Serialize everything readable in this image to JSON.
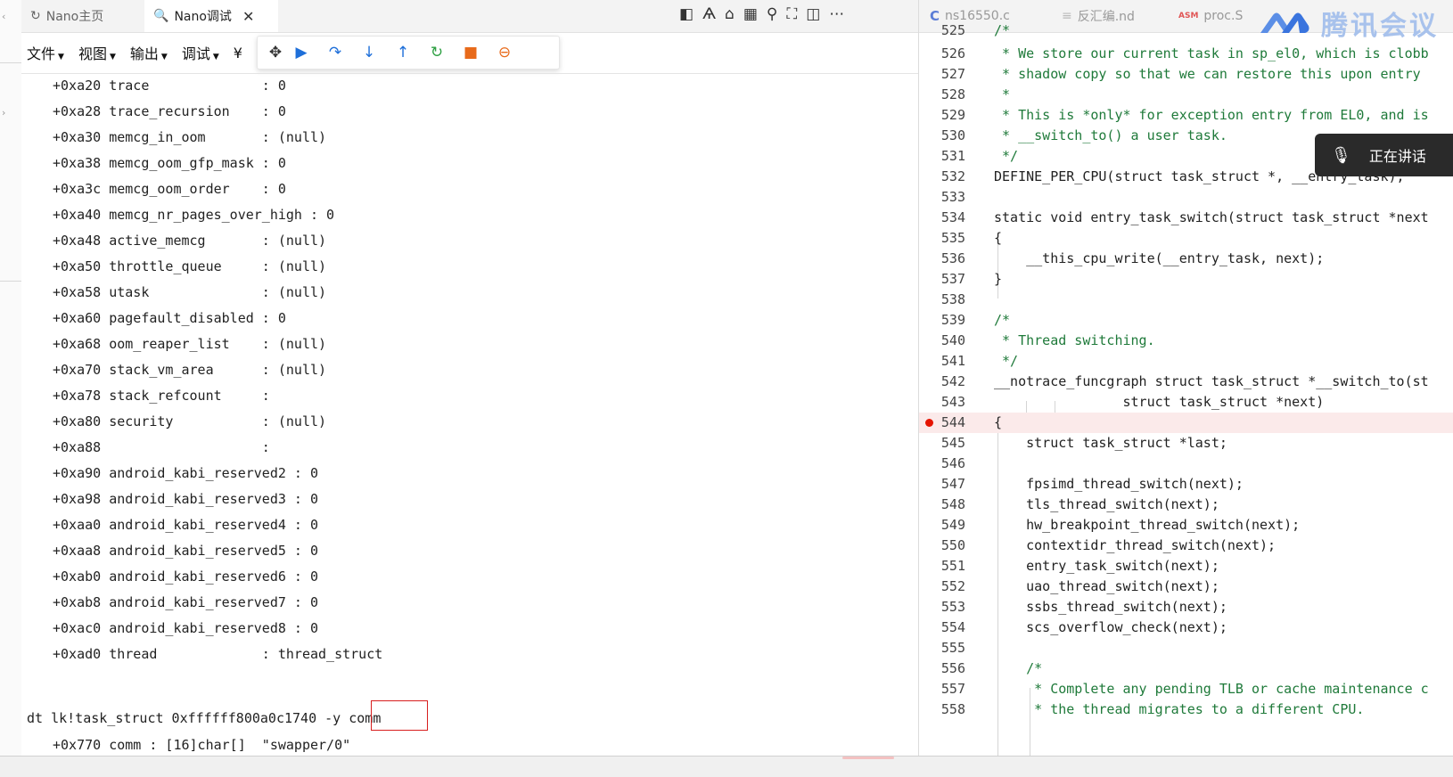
{
  "left_tabs": [
    {
      "label": "Nano主页",
      "active": false,
      "icon": "nano-home-icon"
    },
    {
      "label": "Nano调试",
      "active": true,
      "icon": "debug-search-icon"
    }
  ],
  "menu": [
    "文件",
    "视图",
    "输出",
    "调试",
    "¥"
  ],
  "debug_toolbar": [
    "move-handle-icon",
    "continue-icon",
    "step-over-icon",
    "step-into-icon",
    "step-out-icon",
    "restart-icon",
    "stop-icon",
    "disconnect-icon"
  ],
  "struct_rows": [
    "+0xa20 trace              : 0",
    "+0xa28 trace_recursion    : 0",
    "+0xa30 memcg_in_oom       : (null)",
    "+0xa38 memcg_oom_gfp_mask : 0",
    "+0xa3c memcg_oom_order    : 0",
    "+0xa40 memcg_nr_pages_over_high : 0",
    "+0xa48 active_memcg       : (null)",
    "+0xa50 throttle_queue     : (null)",
    "+0xa58 utask              : (null)",
    "+0xa60 pagefault_disabled : 0",
    "+0xa68 oom_reaper_list    : (null)",
    "+0xa70 stack_vm_area      : (null)",
    "+0xa78 stack_refcount     :",
    "+0xa80 security           : (null)",
    "+0xa88                    :",
    "+0xa90 android_kabi_reserved2 : 0",
    "+0xa98 android_kabi_reserved3 : 0",
    "+0xaa0 android_kabi_reserved4 : 0",
    "+0xaa8 android_kabi_reserved5 : 0",
    "+0xab0 android_kabi_reserved6 : 0",
    "+0xab8 android_kabi_reserved7 : 0",
    "+0xac0 android_kabi_reserved8 : 0",
    "+0xad0 thread             : thread_struct"
  ],
  "command": {
    "text": "dt lk!task_struct 0xffffff800a0c1740 -y ",
    "highlight": "comm",
    "result": "+0x770 comm : [16]char[]  \"swapper/0\""
  },
  "right_tabs": [
    {
      "label": "ns16550.c",
      "icon": "C"
    },
    {
      "label": "反汇编.nd",
      "icon": "≡"
    },
    {
      "label": "proc.S",
      "icon": "ASM"
    }
  ],
  "overlay": {
    "brand": "腾讯会议",
    "speaking": "正在讲话"
  },
  "code_lines": [
    {
      "n": "525",
      "t": "/*",
      "cls": "cmt"
    },
    {
      "n": "526",
      "t": " * We store our current task in sp_el0, which is clobb",
      "cls": "cmt"
    },
    {
      "n": "527",
      "t": " * shadow copy so that we can restore this upon entry",
      "cls": "cmt"
    },
    {
      "n": "528",
      "t": " *",
      "cls": "cmt"
    },
    {
      "n": "529",
      "t": " * This is *only* for exception entry from EL0, and is",
      "cls": "cmt"
    },
    {
      "n": "530",
      "t": " * __switch_to() a user task.",
      "cls": "cmt"
    },
    {
      "n": "531",
      "t": " */",
      "cls": "cmt"
    },
    {
      "n": "532",
      "t": "DEFINE_PER_CPU(struct task_struct *, __entry_task);",
      "cls": ""
    },
    {
      "n": "533",
      "t": "",
      "cls": ""
    },
    {
      "n": "534",
      "t": "static void entry_task_switch(struct task_struct *next",
      "cls": ""
    },
    {
      "n": "535",
      "t": "{",
      "cls": ""
    },
    {
      "n": "536",
      "t": "    __this_cpu_write(__entry_task, next);",
      "cls": ""
    },
    {
      "n": "537",
      "t": "}",
      "cls": ""
    },
    {
      "n": "538",
      "t": "",
      "cls": ""
    },
    {
      "n": "539",
      "t": "/*",
      "cls": "cmt"
    },
    {
      "n": "540",
      "t": " * Thread switching.",
      "cls": "cmt"
    },
    {
      "n": "541",
      "t": " */",
      "cls": "cmt"
    },
    {
      "n": "542",
      "t": "__notrace_funcgraph struct task_struct *__switch_to(st",
      "cls": ""
    },
    {
      "n": "543",
      "t": "                struct task_struct *next)",
      "cls": ""
    },
    {
      "n": "544",
      "t": "{",
      "cls": "bp"
    },
    {
      "n": "545",
      "t": "    struct task_struct *last;",
      "cls": ""
    },
    {
      "n": "546",
      "t": "",
      "cls": ""
    },
    {
      "n": "547",
      "t": "    fpsimd_thread_switch(next);",
      "cls": ""
    },
    {
      "n": "548",
      "t": "    tls_thread_switch(next);",
      "cls": ""
    },
    {
      "n": "549",
      "t": "    hw_breakpoint_thread_switch(next);",
      "cls": ""
    },
    {
      "n": "550",
      "t": "    contextidr_thread_switch(next);",
      "cls": ""
    },
    {
      "n": "551",
      "t": "    entry_task_switch(next);",
      "cls": ""
    },
    {
      "n": "552",
      "t": "    uao_thread_switch(next);",
      "cls": ""
    },
    {
      "n": "553",
      "t": "    ssbs_thread_switch(next);",
      "cls": ""
    },
    {
      "n": "554",
      "t": "    scs_overflow_check(next);",
      "cls": ""
    },
    {
      "n": "555",
      "t": "",
      "cls": ""
    },
    {
      "n": "556",
      "t": "    /*",
      "cls": "cmt"
    },
    {
      "n": "557",
      "t": "     * Complete any pending TLB or cache maintenance c",
      "cls": "cmt"
    },
    {
      "n": "558",
      "t": "     * the thread migrates to a different CPU.",
      "cls": "cmt"
    }
  ],
  "colors": {
    "breakpoint": "#e51400",
    "breakpoint_line": "#fbeaea",
    "highlight_box": "#d81e1e",
    "comment": "#1f7a3a",
    "keyword": "#1a4fbf"
  }
}
